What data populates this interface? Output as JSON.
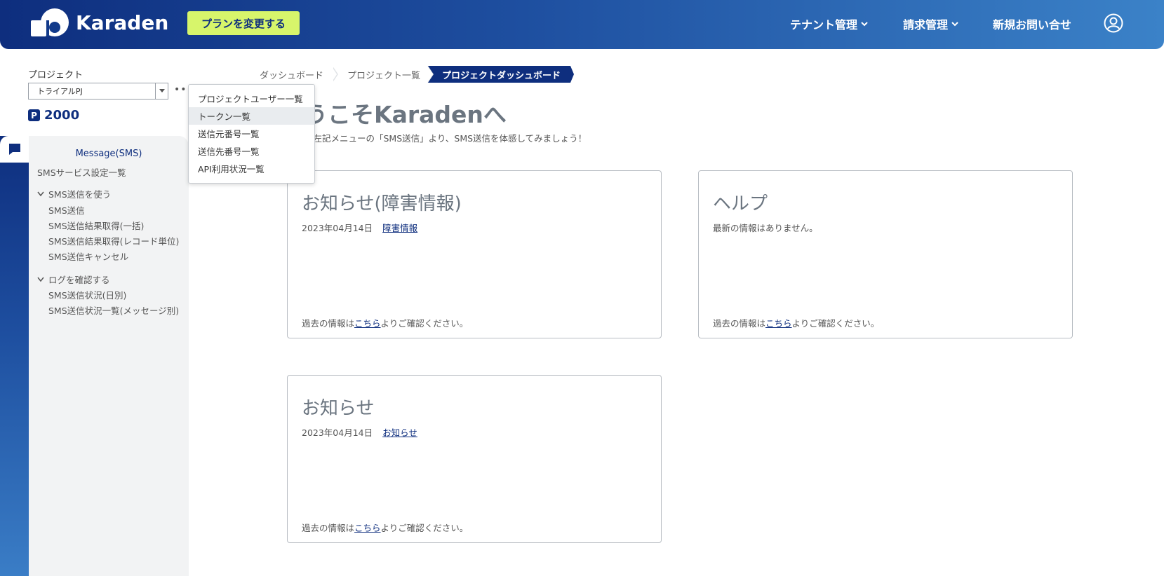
{
  "header": {
    "logo_text": "Karaden",
    "plan_button": "プランを変更する",
    "nav": [
      "テナント管理",
      "請求管理",
      "新規お問い合せ"
    ]
  },
  "project": {
    "label": "プロジェクト",
    "selected": "トライアルPJ",
    "points_badge": "P",
    "points": "2000"
  },
  "dropdown": {
    "items": [
      "プロジェクトユーザー一覧",
      "トークン一覧",
      "送信元番号一覧",
      "送信先番号一覧",
      "API利用状況一覧"
    ],
    "active_index": 1
  },
  "sidebar": {
    "title": "Message(SMS)",
    "service_settings": "SMSサービス設定一覧",
    "group1": {
      "label": "SMS送信を使う",
      "items": [
        "SMS送信",
        "SMS送信結果取得(一括)",
        "SMS送信結果取得(レコード単位)",
        "SMS送信キャンセル"
      ]
    },
    "group2": {
      "label": "ログを確認する",
      "items": [
        "SMS送信状況(日別)",
        "SMS送信状況一覧(メッセージ別)"
      ]
    }
  },
  "breadcrumb": [
    "ダッシュボード",
    "プロジェクト一覧",
    "プロジェクトダッシュボード"
  ],
  "welcome": {
    "title": "うこそKaradenへ",
    "subtitle": "く左記メニューの「SMS送信」より、SMS送信を体感してみましょう！"
  },
  "cards": [
    {
      "title": "お知らせ(障害情報)",
      "date": "2023年04月14日",
      "link": "障害情報",
      "empty": "",
      "foot_prefix": "過去の情報は",
      "foot_link": "こちら",
      "foot_suffix": "よりご確認ください。"
    },
    {
      "title": "ヘルプ",
      "date": "",
      "link": "",
      "empty": "最新の情報はありません。",
      "foot_prefix": "過去の情報は",
      "foot_link": "こちら",
      "foot_suffix": "よりご確認ください。"
    },
    {
      "title": "お知らせ",
      "date": "2023年04月14日",
      "link": "お知らせ",
      "empty": "",
      "foot_prefix": "過去の情報は",
      "foot_link": "こちら",
      "foot_suffix": "よりご確認ください。"
    }
  ],
  "colors": {
    "brand": "#0e2e7e",
    "accent": "#d7f56b"
  }
}
